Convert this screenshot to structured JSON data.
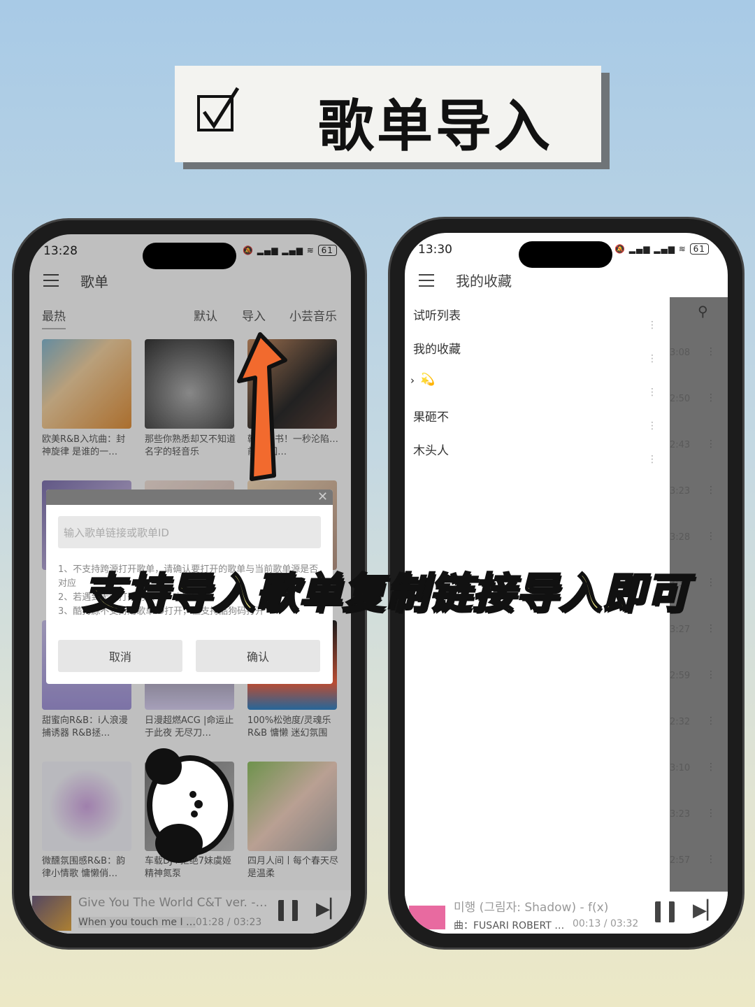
{
  "header_card": {
    "title": "歌单导入",
    "icon": "checkbox-checked-icon"
  },
  "left_phone": {
    "status": {
      "time": "13:28",
      "battery": "61"
    },
    "app_title": "歌单",
    "tabs": {
      "hot": "最热",
      "default": "默认",
      "import": "导入",
      "source": "小芸音乐"
    },
    "playlists": [
      {
        "caption": "欧美R&B入坑曲：封神旋律 是谁的一…"
      },
      {
        "caption": "那些你熟悉却又不知道名字的轻音乐"
      },
      {
        "caption": "韩…科书！一秒沦陷…前奏 回…"
      },
      {
        "caption": "甜蜜向R&B：i人浪漫捕诱器 R&B拯…"
      },
      {
        "caption": "日漫超燃ACG |命运止于此夜 无尽刀…"
      },
      {
        "caption": "100%松弛度/灵魂乐R&B 慵懒 迷幻氛围"
      },
      {
        "caption": "微醺氛围感R&B：韵律小情歌 慵懒俏…"
      },
      {
        "caption": "车载DJ↑拒绝7妹虞姬精神氮泵"
      },
      {
        "caption": "四月人间丨每个春天尽是温柔"
      }
    ],
    "dialog": {
      "input_placeholder": "输入歌单链接或歌单ID",
      "notes": [
        "1、不支持跨源打开歌单，请确认要打开的歌单与当前歌单源是否对应",
        "2、若遇到无法打开的歌单，欢迎反馈",
        "3、酷狗源不支持用歌单ID打开，但支持酷狗码打开"
      ],
      "cancel": "取消",
      "confirm": "确认"
    },
    "player": {
      "title": "Give You The World C&T ver. -…",
      "lyric": "When you touch me I …",
      "progress": "01:28 / 03:23"
    }
  },
  "right_phone": {
    "status": {
      "time": "13:30",
      "battery": "61"
    },
    "app_title": "我的收藏",
    "lists": [
      {
        "name": "试听列表"
      },
      {
        "name": "我的收藏"
      },
      {
        "name": "💫"
      },
      {
        "name": "果砸不"
      },
      {
        "name": "木头人"
      }
    ],
    "durations": [
      "3:08",
      "2:50",
      "2:43",
      "3:23",
      "3:28",
      "3:32",
      "3:27",
      "2:59",
      "2:32",
      "3:10",
      "3:23",
      "2:57"
    ],
    "player": {
      "title": "미행 (그림자: Shadow) - f(x)",
      "lyric": "曲：FUSARI ROBERT …",
      "progress": "00:13 / 03:32"
    }
  },
  "caption_overlay": "支持导入歌单复制链接导入即可",
  "colors": {
    "arrow": "#f26a2e",
    "overlay_text": "#fbf58a"
  }
}
